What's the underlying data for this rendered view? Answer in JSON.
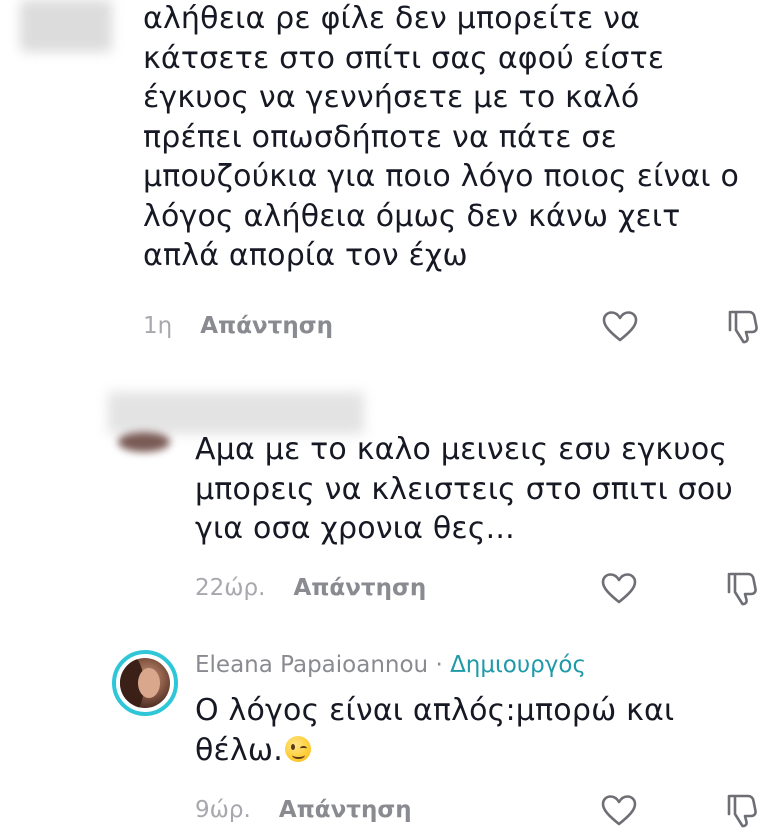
{
  "comments": [
    {
      "text": "αλήθεια ρε φίλε δεν μπορείτε να\nκάτσετε στο σπίτι σας αφού είστε\nέγκυος να γεννήσετε με το καλό\nπρέπει οπωσδήποτε να πάτε σε\nμπουζούκια για ποιο λόγο ποιος είναι ο\nλόγος αλήθεια όμως δεν κάνω χειτ\nαπλά απορία τον έχω",
      "time": "1η",
      "reply_label": "Απάντηση",
      "like_icon": "heart-outline-icon",
      "dislike_icon": "thumbs-down-outline-icon"
    },
    {
      "text": "Αμα με το καλο μεινεις εσυ εγκυος\nμπορεις να κλειστεις στο σπιτι σου\nγια οσα χρονια θες...",
      "time": "22ώρ.",
      "reply_label": "Απάντηση",
      "like_icon": "heart-outline-icon",
      "dislike_icon": "thumbs-down-outline-icon"
    },
    {
      "author": "Eleana Papaioannou",
      "separator": "·",
      "badge": "Δημιουργός",
      "text_line1": "Ο λόγος είναι απλός:μπορώ και",
      "text_line2": "θέλω.",
      "emoji": "winking-face-emoji",
      "time": "9ώρ.",
      "reply_label": "Απάντηση",
      "like_icon": "heart-outline-icon",
      "dislike_icon": "thumbs-down-outline-icon"
    }
  ],
  "colors": {
    "text": "#161823",
    "meta": "#a7a8ad",
    "reply": "#8a8b91",
    "creator_badge": "#1f9aa8",
    "avatar_ring": "#2fc6d8"
  }
}
